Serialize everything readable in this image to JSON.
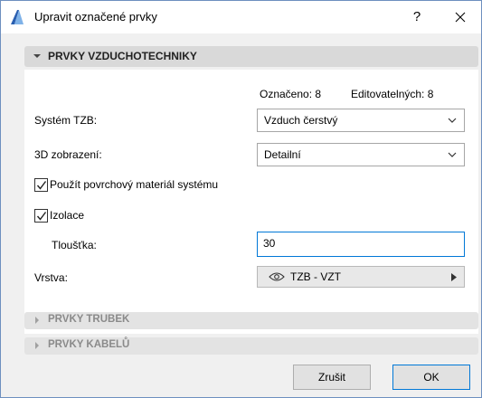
{
  "window": {
    "title": "Upravit označené prvky",
    "help_label": "?"
  },
  "section_hvac": {
    "title": "PRVKY VZDUCHOTECHNIKY",
    "marked_label": "Označeno: 8",
    "editable_label": "Editovatelných: 8",
    "system_label": "Systém TZB:",
    "system_value": "Vzduch čerstvý",
    "display3d_label": "3D zobrazení:",
    "display3d_value": "Detailní",
    "surface_checkbox_label": "Použít povrchový materiál systému",
    "surface_checked": true,
    "insulation_checkbox_label": "Izolace",
    "insulation_checked": true,
    "thickness_label": "Tloušťka:",
    "thickness_value": "30",
    "layer_label": "Vrstva:",
    "layer_value": "TZB - VZT"
  },
  "section_pipes": {
    "title": "PRVKY TRUBEK"
  },
  "section_cables": {
    "title": "PRVKY KABELŮ"
  },
  "footer": {
    "cancel_label": "Zrušit",
    "ok_label": "OK"
  },
  "colors": {
    "accent": "#0078d7",
    "section_header": "#d9d9d9",
    "background": "#f0f0f0"
  },
  "icons": {
    "app": "archicad-icon",
    "close": "close-icon",
    "expand": "triangle-down-icon",
    "collapse": "triangle-right-icon",
    "dropdown": "chevron-down-icon",
    "visibility": "eye-icon"
  }
}
